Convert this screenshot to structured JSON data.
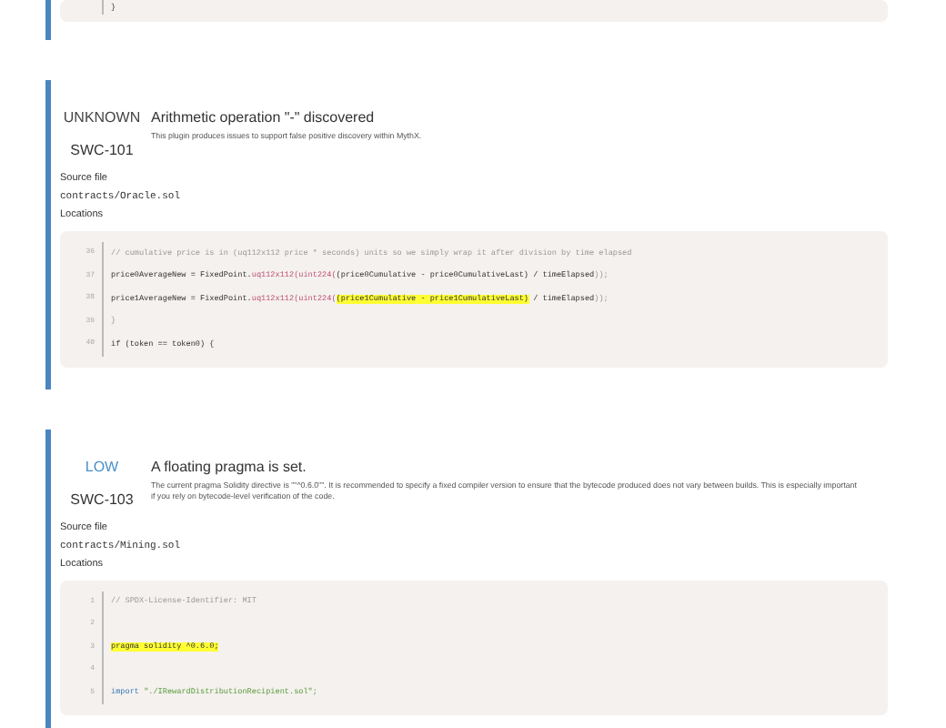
{
  "previous": {
    "code": [
      {
        "segments": [
          {
            "text": "}",
            "highlight": false
          }
        ]
      }
    ]
  },
  "issues": [
    {
      "severity": "UNKNOWN",
      "swc": "SWC-101",
      "title": "Arithmetic operation \"-\" discovered",
      "description": "This plugin produces issues to support false positive discovery within MythX.",
      "source_label": "Source file",
      "source_file": "contracts/Oracle.sol",
      "locations_label": "Locations",
      "code": [
        {
          "number": "36",
          "segments": [
            {
              "kind": "comment",
              "text": "// cumulative price is in (uq112x112 price * seconds) units so we simply wrap it after division by time elapsed",
              "highlight": false
            }
          ]
        },
        {
          "number": "37",
          "segments": [
            {
              "kind": "plain",
              "text": "price0AverageNew = FixedPoint.",
              "highlight": false
            },
            {
              "kind": "type",
              "text": "uq112x112(uint224(",
              "highlight": false
            },
            {
              "kind": "plain",
              "text": "(price0Cumulative - price0CumulativeLast) / timeElapsed",
              "highlight": false
            },
            {
              "kind": "comment",
              "text": "));",
              "highlight": false
            }
          ]
        },
        {
          "number": "38",
          "segments": [
            {
              "kind": "plain",
              "text": "price1AverageNew = FixedPoint.",
              "highlight": false
            },
            {
              "kind": "type",
              "text": "uq112x112(uint224(",
              "highlight": false
            },
            {
              "kind": "plain",
              "text": "(price1Cumulative - price1CumulativeLast)",
              "highlight": true
            },
            {
              "kind": "plain",
              "text": " / timeElapsed",
              "highlight": false
            },
            {
              "kind": "comment",
              "text": "));",
              "highlight": false
            }
          ]
        },
        {
          "number": "39",
          "segments": [
            {
              "kind": "comment",
              "text": "}",
              "highlight": false
            }
          ]
        },
        {
          "number": "40",
          "segments": [
            {
              "kind": "plain",
              "text": "if (token == token0) {",
              "highlight": false
            }
          ]
        }
      ]
    },
    {
      "severity": "LOW",
      "swc": "SWC-103",
      "title": "A floating pragma is set.",
      "description": "The current pragma Solidity directive is \"\"^0.6.0\"\". It is recommended to specify a fixed compiler version to ensure that the bytecode produced does not vary between builds. This is especially important if you rely on bytecode-level verification of the code.",
      "source_label": "Source file",
      "source_file": "contracts/Mining.sol",
      "locations_label": "Locations",
      "code": [
        {
          "number": "1",
          "segments": [
            {
              "kind": "comment",
              "text": "// SPDX-License-Identifier: MIT",
              "highlight": false
            }
          ]
        },
        {
          "number": "2"
        },
        {
          "number": "3",
          "segments": [
            {
              "kind": "plain",
              "text": "pragma solidity ^0.6.0;",
              "highlight": true
            }
          ]
        },
        {
          "number": "4"
        },
        {
          "number": "5",
          "segments": [
            {
              "kind": "keyword",
              "text": "import",
              "highlight": false
            },
            {
              "kind": "string",
              "text": " \"./IRewardDistributionRecipient.sol\";",
              "highlight": false
            }
          ]
        }
      ]
    }
  ]
}
